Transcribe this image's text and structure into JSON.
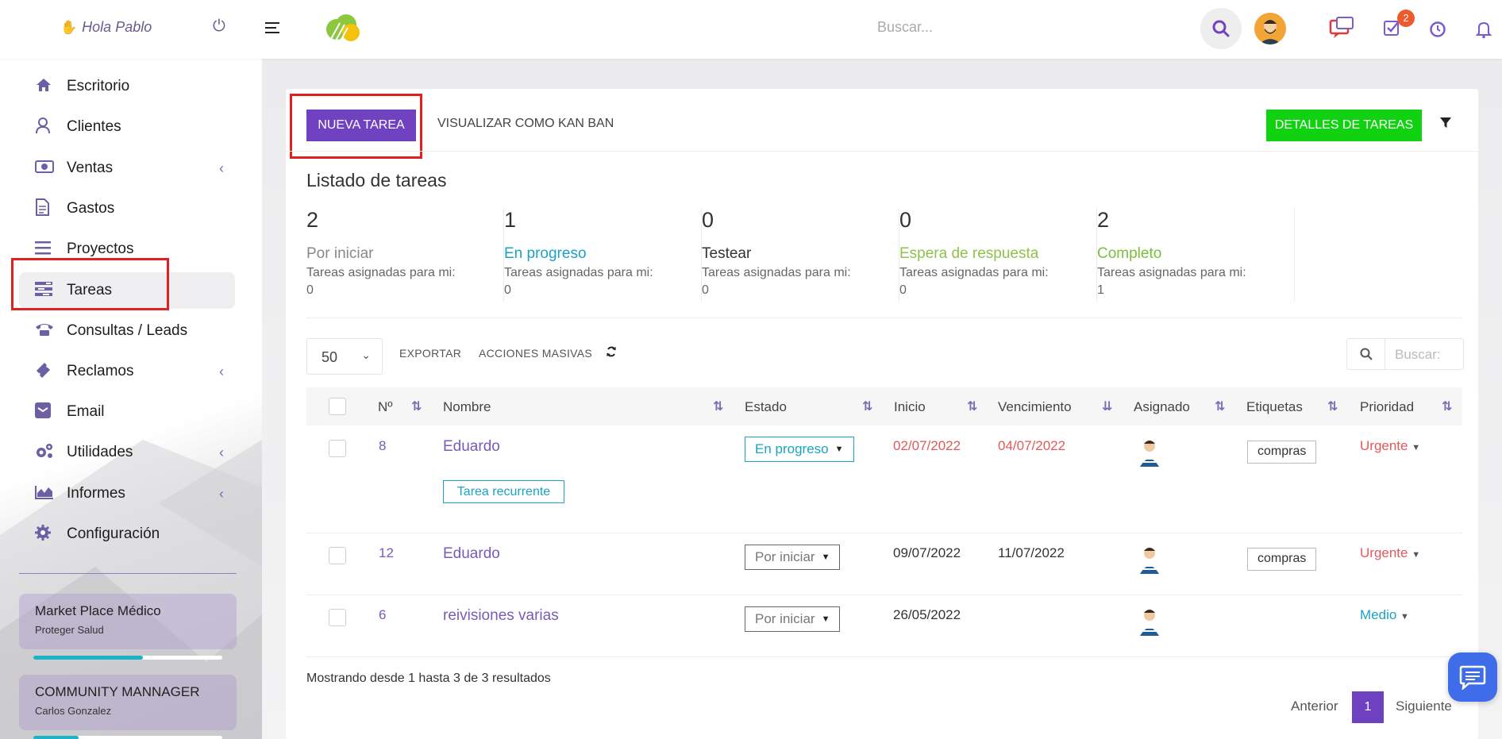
{
  "header": {
    "greeting": "Hola Pablo",
    "search_placeholder": "Buscar...",
    "tasks_badge": "2"
  },
  "sidebar": {
    "items": [
      {
        "label": "Escritorio",
        "icon": "home-icon"
      },
      {
        "label": "Clientes",
        "icon": "user-icon"
      },
      {
        "label": "Ventas",
        "icon": "money-icon"
      },
      {
        "label": "Gastos",
        "icon": "file-icon"
      },
      {
        "label": "Proyectos",
        "icon": "bars-icon"
      },
      {
        "label": "Tareas",
        "icon": "tasks-icon"
      },
      {
        "label": "Consultas / Leads",
        "icon": "phone-icon"
      },
      {
        "label": "Reclamos",
        "icon": "ticket-icon"
      },
      {
        "label": "Email",
        "icon": "envelope-icon"
      },
      {
        "label": "Utilidades",
        "icon": "gears-icon"
      },
      {
        "label": "Informes",
        "icon": "area-chart-icon"
      },
      {
        "label": "Configuración",
        "icon": "gear-icon"
      }
    ],
    "projects": [
      {
        "title": "Market Place Médico",
        "subtitle": "Proteger Salud",
        "progress": 0.58
      },
      {
        "title": "COMMUNITY MANNAGER",
        "subtitle": "Carlos Gonzalez",
        "progress": 0.24
      }
    ]
  },
  "toolbar": {
    "new_task": "NUEVA TAREA",
    "kanban": "VISUALIZAR COMO KAN BAN",
    "details": "DETALLES DE TAREAS"
  },
  "list": {
    "title": "Listado de tareas",
    "stats": [
      {
        "count": "2",
        "label": "Por iniciar",
        "sub": "Tareas asignadas para mi:",
        "mine": "0",
        "color": "#888888"
      },
      {
        "count": "1",
        "label": "En progreso",
        "sub": "Tareas asignadas para mi:",
        "mine": "0",
        "color": "#1aa3c4"
      },
      {
        "count": "0",
        "label": "Testear",
        "sub": "Tareas asignadas para mi:",
        "mine": "0",
        "color": "#333333"
      },
      {
        "count": "0",
        "label": "Espera de respuesta",
        "sub": "Tareas asignadas para mi:",
        "mine": "0",
        "color": "#8ec24a"
      },
      {
        "count": "2",
        "label": "Completo",
        "sub": "Tareas asignadas para mi:",
        "mine": "1",
        "color": "#7bbf3a"
      }
    ]
  },
  "table_tools": {
    "page_size": "50",
    "export": "EXPORTAR",
    "bulk": "ACCIONES MASIVAS",
    "search_placeholder": "Buscar:"
  },
  "table": {
    "headers": {
      "num": "Nº",
      "name": "Nombre",
      "status": "Estado",
      "start": "Inicio",
      "due": "Vencimiento",
      "assigned": "Asignado",
      "tags": "Etiquetas",
      "priority": "Prioridad"
    },
    "rows": [
      {
        "id": "8",
        "name": "Eduardo",
        "recurring": "Tarea recurrente",
        "status": "En progreso",
        "start": "02/07/2022",
        "due": "04/07/2022",
        "tag": "compras",
        "priority": "Urgente"
      },
      {
        "id": "12",
        "name": "Eduardo",
        "status": "Por iniciar",
        "start": "09/07/2022",
        "due": "11/07/2022",
        "tag": "compras",
        "priority": "Urgente"
      },
      {
        "id": "6",
        "name": "reivisiones varias",
        "status": "Por iniciar",
        "start": "26/05/2022",
        "due": "",
        "tag": "",
        "priority": "Medio"
      }
    ]
  },
  "footer": {
    "showing": "Mostrando desde 1 hasta 3 de 3 resultados",
    "prev": "Anterior",
    "page": "1",
    "next": "Siguiente"
  },
  "colors": {
    "primary": "#7042c2",
    "success": "#10d210",
    "overdue": "#e05a5a",
    "info": "#1aa3c4"
  }
}
